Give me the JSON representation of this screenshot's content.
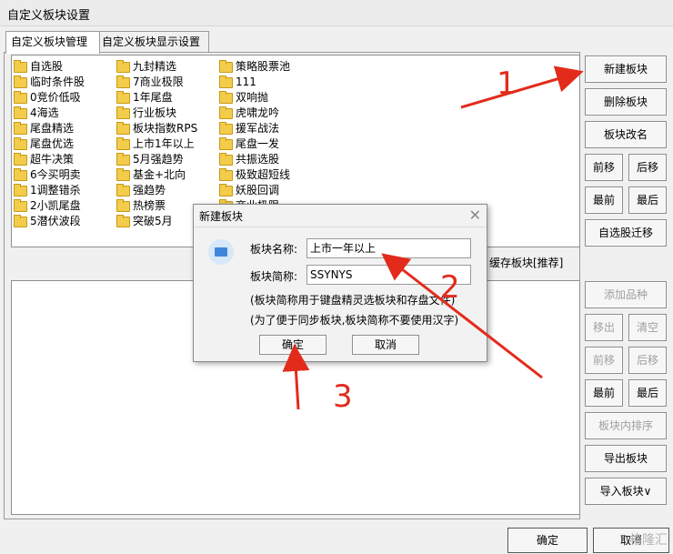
{
  "window": {
    "title": "自定义板块设置"
  },
  "tabs": [
    {
      "label": "自定义板块管理"
    },
    {
      "label": "自定义板块显示设置"
    }
  ],
  "blocks": {
    "col1": [
      "自选股",
      "临时条件股",
      "0竞价低吸",
      "4海选",
      "尾盘精选",
      "尾盘优选",
      "超牛决策",
      "6今买明卖",
      "1调整错杀",
      "2小凯尾盘",
      "5潜伏波段"
    ],
    "col2": [
      "九封精选",
      "7商业极限",
      "1年尾盘",
      "行业板块",
      "板块指数RPS",
      "上市1年以上",
      "5月强趋势",
      "基金+北向",
      "强趋势",
      "热榜票",
      "突破5月"
    ],
    "col3": [
      "策略股票池",
      "111",
      "双响抛",
      "虎啸龙吟",
      "援军战法",
      "尾盘一发",
      "共振选股",
      "极致超短线",
      "妖股回调",
      "商业极限"
    ]
  },
  "right_buttons": {
    "new": "新建板块",
    "delete": "删除板块",
    "rename": "板块改名",
    "move_up": "前移",
    "move_down": "后移",
    "top": "最前",
    "bottom": "最后",
    "migrate": "自选股迁移"
  },
  "cache_label": "缓存板块[推荐]",
  "stock_buttons": {
    "add": "添加品种",
    "remove": "移出",
    "clear": "清空",
    "move_up": "前移",
    "move_down": "后移",
    "top": "最前",
    "bottom": "最后",
    "sort": "板块内排序",
    "export": "导出板块",
    "import": "导入板块∨"
  },
  "footer": {
    "ok": "确定",
    "cancel": "取消"
  },
  "dialog": {
    "title": "新建板块",
    "name_label": "板块名称:",
    "name_value": "上市一年以上",
    "abbr_label": "板块简称:",
    "abbr_value": "SSYNYS",
    "note1": "(板块简称用于键盘精灵选板块和存盘文件)",
    "note2": "(为了便于同步板块,板块简称不要使用汉字)",
    "ok": "确定",
    "cancel": "取消"
  },
  "annotations": {
    "n1": "1",
    "n2": "2",
    "n3": "3",
    "arrow_color": "#e32b1c"
  },
  "watermark": "格隆汇"
}
